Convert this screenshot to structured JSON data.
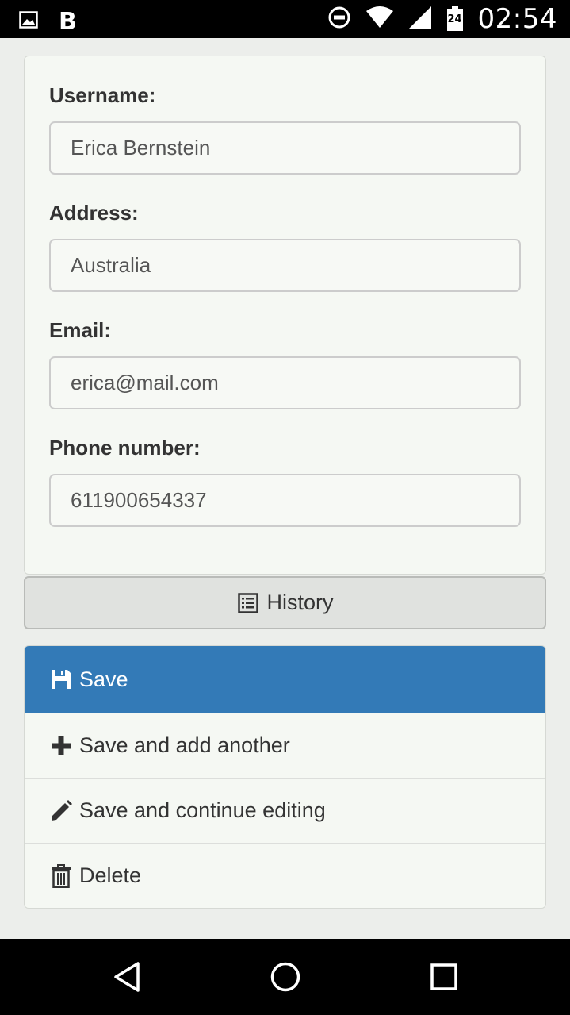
{
  "status_bar": {
    "left_letter": "B",
    "battery_level": "24",
    "time": "02:54"
  },
  "form": {
    "username": {
      "label": "Username:",
      "value": "Erica Bernstein"
    },
    "address": {
      "label": "Address:",
      "value": "Australia"
    },
    "email": {
      "label": "Email:",
      "value": "erica@mail.com"
    },
    "phone": {
      "label": "Phone number:",
      "value": "611900654337"
    }
  },
  "history_button": {
    "label": "History",
    "icon": "list-icon"
  },
  "actions": [
    {
      "label": "Save",
      "icon": "floppy-disk-icon"
    },
    {
      "label": "Save and add another",
      "icon": "plus-icon"
    },
    {
      "label": "Save and continue editing",
      "icon": "pencil-icon"
    },
    {
      "label": "Delete",
      "icon": "trash-icon"
    }
  ],
  "colors": {
    "primary": "#337ab7",
    "page_background": "#eceeeb",
    "panel_background": "#f5f8f3"
  }
}
